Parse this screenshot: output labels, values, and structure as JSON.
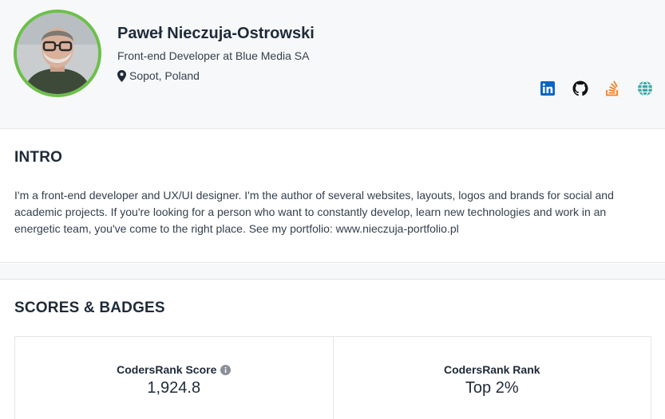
{
  "profile": {
    "name": "Paweł Nieczuja-Ostrowski",
    "job": "Front-end Developer at Blue Media SA",
    "location": "Sopot, Poland",
    "avatar_ring_color": "#6cc04a"
  },
  "socials": [
    {
      "icon": "linkedin-icon",
      "color": "#0a66c2"
    },
    {
      "icon": "github-icon",
      "color": "#111111"
    },
    {
      "icon": "stackoverflow-icon",
      "color": "#f48024"
    },
    {
      "icon": "globe-icon",
      "color": "#3aa6a6"
    }
  ],
  "intro": {
    "title": "INTRO",
    "text": "I'm a front-end developer and UX/UI designer. I'm the author of several websites, layouts, logos and brands for social and academic projects. If you're looking for a person who want to constantly develop, learn new technologies and work in an energetic team, you've come to the right place. See my portfolio: www.nieczuja-portfolio.pl"
  },
  "scores": {
    "title": "SCORES & BADGES",
    "cards": [
      {
        "label": "CodersRank Score",
        "value": "1,924.8"
      },
      {
        "label": "CodersRank Rank",
        "value": "Top 2%"
      }
    ]
  }
}
